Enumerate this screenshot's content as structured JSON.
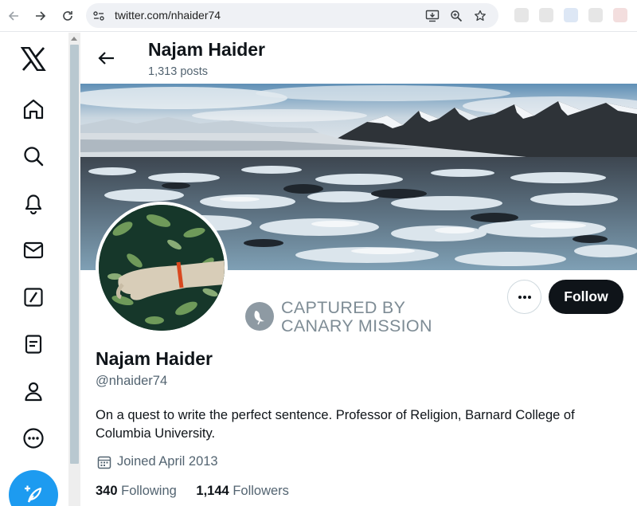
{
  "browser": {
    "url": "twitter.com/nhaider74"
  },
  "sidebar": {
    "items": [
      {
        "icon": "x-logo-icon"
      },
      {
        "icon": "home-icon"
      },
      {
        "icon": "search-icon"
      },
      {
        "icon": "notifications-bell-icon"
      },
      {
        "icon": "messages-envelope-icon"
      },
      {
        "icon": "grok-icon"
      },
      {
        "icon": "lists-icon"
      },
      {
        "icon": "profile-icon"
      },
      {
        "icon": "more-circle-icon"
      }
    ],
    "post_button_icon": "feather-plus-icon"
  },
  "header": {
    "name": "Najam Haider",
    "posts": "1,313 posts"
  },
  "profile": {
    "name": "Najam Haider",
    "handle": "@nhaider74",
    "bio": "On a quest to write the perfect sentence. Professor of Religion, Barnard College of Columbia University.",
    "joined": "Joined April 2013",
    "following_count": "340",
    "following_label": "Following",
    "followers_count": "1,144",
    "followers_label": "Followers"
  },
  "actions": {
    "follow_label": "Follow",
    "more_icon": "more-dots-icon"
  },
  "watermark": {
    "line1": "CAPTURED BY",
    "line2": "CANARY MISSION"
  },
  "colors": {
    "accent": "#1d9bf0",
    "follow_button": "#0f1419",
    "secondary_text": "#536471"
  }
}
